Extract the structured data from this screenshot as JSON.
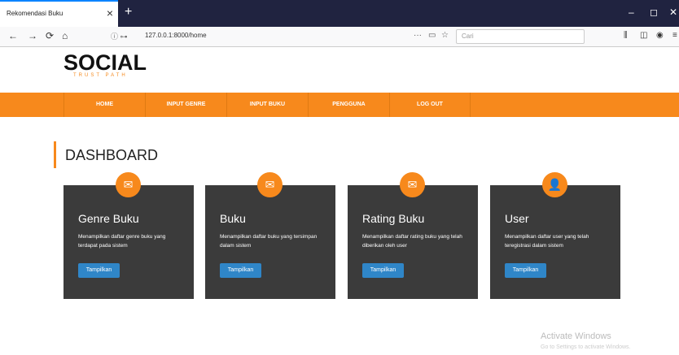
{
  "browser": {
    "tab_title": "Rekomendasi Buku",
    "tab_close": "×",
    "new_tab": "+",
    "win_min": "–",
    "win_max": "◻",
    "win_close": "✕",
    "url": "127.0.0.1:8000/home",
    "search_placeholder": "Cari",
    "back": "←",
    "forward": "→",
    "reload": "⟳",
    "home": "⌂"
  },
  "logo": {
    "main": "SOCIAL",
    "sub": "TRUST PATH"
  },
  "menu": {
    "items": [
      {
        "label": "HOME"
      },
      {
        "label": "INPUT GENRE"
      },
      {
        "label": "INPUT BUKU"
      },
      {
        "label": "PENGGUNA"
      },
      {
        "label": "LOG OUT"
      }
    ]
  },
  "dashboard": {
    "title": "DASHBOARD"
  },
  "cards": [
    {
      "title": "Genre Buku",
      "desc": "Menampilkan daftar genre buku yang terdapat pada sistem",
      "button": "Tampilkan",
      "icon": "✉"
    },
    {
      "title": "Buku",
      "desc": "Menampilkan daftar buku yang tersimpan dalam sistem",
      "button": "Tampilkan",
      "icon": "✉"
    },
    {
      "title": "Rating Buku",
      "desc": "Menampilkan daftar rating buku yang telah diberikan oleh user",
      "button": "Tampilkan",
      "icon": "✉"
    },
    {
      "title": "User",
      "desc": "Menampilkan daftar user yang telah teregistrasi dalam sistem",
      "button": "Tampilkan",
      "icon": "👤"
    }
  ],
  "watermark": {
    "line1": "Activate Windows",
    "line2": "Go to Settings to activate Windows."
  },
  "colors": {
    "accent": "#f7891c",
    "card_bg": "#3b3b3b",
    "button": "#2f86c8"
  }
}
